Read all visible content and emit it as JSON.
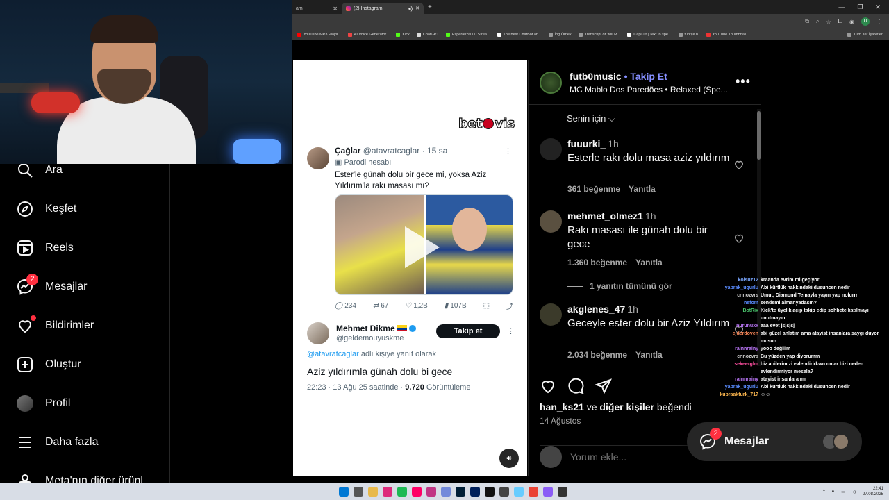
{
  "browser": {
    "tabs": [
      {
        "label": "am",
        "active": false
      },
      {
        "label": "(2) Instagram",
        "active": true
      }
    ],
    "bookmarks": [
      "YouTube MP3 Playli...",
      "AI Voice Generator...",
      "Kick",
      "ChatGPT",
      "Esperanza000 Strea...",
      "The best ChatBot an...",
      "İng Örnek",
      "Transcript of \"Mil M...",
      "CapCut | Text to spe...",
      "türkçe h.",
      "YouTube Thumbnail..."
    ],
    "all_bookmarks": "Tüm Yer İşaretleri",
    "profile_initial": "U"
  },
  "nav": {
    "items": [
      {
        "label": "Ara",
        "icon": "search-icon"
      },
      {
        "label": "Keşfet",
        "icon": "compass-icon"
      },
      {
        "label": "Reels",
        "icon": "reels-icon"
      },
      {
        "label": "Mesajlar",
        "icon": "messenger-icon",
        "badge": "2"
      },
      {
        "label": "Bildirimler",
        "icon": "heart-icon"
      },
      {
        "label": "Oluştur",
        "icon": "plus-square-icon"
      },
      {
        "label": "Profil",
        "icon": "avatar"
      },
      {
        "label": "Daha fazla",
        "icon": "hamburger-icon"
      },
      {
        "label": "Meta'nın diğer ürünl",
        "icon": "meta-icon"
      }
    ]
  },
  "media": {
    "brand": "betovis",
    "tweet1": {
      "name": "Çağlar",
      "handle": "@atavratcaglar · 15 sa",
      "badge": "Parodi hesabı",
      "text": "Ester'le günah dolu bir gece mi, yoksa Aziz Yıldırım'la rakı masası mı?"
    },
    "stats": {
      "replies": "234",
      "retweets": "67",
      "likes": "1,2B",
      "views": "107B"
    },
    "tweet2": {
      "name": "Mehmet Dikme",
      "handle": "@geldemouyuskme",
      "follow": "Takip et",
      "reply_mention": "@atavratcaglar",
      "reply_suffix": " adlı kişiye yanıt olarak",
      "text": "Aziz yıldırımla günah dolu bi gece",
      "meta_prefix": "22:23 · 13 Ağu 25 saatinde · ",
      "meta_views": "9.720",
      "meta_suffix": " Görüntüleme"
    }
  },
  "side": {
    "username": "futb0music",
    "follow": "• Takip Et",
    "music": "MC Mablo Dos Paredões • Relaxed (Spe...",
    "sort": "Senin için ⌵",
    "comments": [
      {
        "user": "fuuurki_",
        "time": "1h",
        "text": "Esterle rakı dolu masa aziz yıldırım",
        "likes": "361 beğenme",
        "reply": "Yanıtla"
      },
      {
        "user": "mehmet_olmez1",
        "time": "1h",
        "text": "Rakı masası ile günah dolu bir gece",
        "likes": "1.360 beğenme",
        "reply": "Yanıtla"
      },
      {
        "user": "akglenes_47",
        "time": "1h",
        "text": "Geceyle ester dolu bir Aziz Yıldırım",
        "likes": "2.034 beğenme",
        "reply": "Yanıtla"
      }
    ],
    "view_replies": "1 yanıtın tümünü gör",
    "likes_user": "han_ks21",
    "likes_mid": " ve ",
    "likes_others": "diğer kişiler",
    "likes_suffix": " beğendi",
    "date": "14 Ağustos",
    "comment_placeholder": "Yorum ekle..."
  },
  "messages": {
    "label": "Mesajlar",
    "badge": "2"
  },
  "chat": [
    {
      "user": "kolsuz12",
      "msg": "kraanda evrim mi geçiyor",
      "color": "#7aa7ff"
    },
    {
      "user": "yaprak_ugurlu",
      "msg": "Abi kürtlük hakkındaki dusuncen nedir",
      "color": "#5a8cff"
    },
    {
      "user": "cnnozvrs",
      "msg": "Umut, Diamond Temayla yayın yap nolurrr",
      "color": "#d0d0d0"
    },
    {
      "user": "nefom",
      "msg": "sendemi almanyadasın?",
      "color": "#5a8cff"
    },
    {
      "user": "BotRix",
      "msg": "Kick'te üyelik açıp takip edip sohbete katılmayı unutmayın!",
      "color": "#49c26b"
    },
    {
      "user": "nurunuxx",
      "msg": "aaa evet jsjsjsj",
      "color": "#c07aff"
    },
    {
      "user": "ejderdoven",
      "msg": "abi güzel anlatım ama atayist insanlara saygı duyor musun",
      "color": "#ff8a5a"
    },
    {
      "user": "rainnrainy",
      "msg": "yooo değilim",
      "color": "#c07aff"
    },
    {
      "user": "cnnozvrs",
      "msg": "Bu yüzden yap diyorumm",
      "color": "#d0d0d0"
    },
    {
      "user": "sekeerglm",
      "msg": "biz abilerimizi evlendirirkwn onlar bizi neden evlendirmiyor mesela?",
      "color": "#ff4fa0"
    },
    {
      "user": "rainnrainy",
      "msg": "atayist insanlara mı",
      "color": "#c07aff"
    },
    {
      "user": "yaprak_ugurlu",
      "msg": "Abi kürtlük hakkındaki dusuncen nedir",
      "color": "#5a8cff"
    },
    {
      "user": "kubraakturk_717",
      "msg": "☺☺",
      "color": "#ffb84f"
    }
  ],
  "clock": {
    "time": "22:41",
    "date": "27.08.2025"
  }
}
